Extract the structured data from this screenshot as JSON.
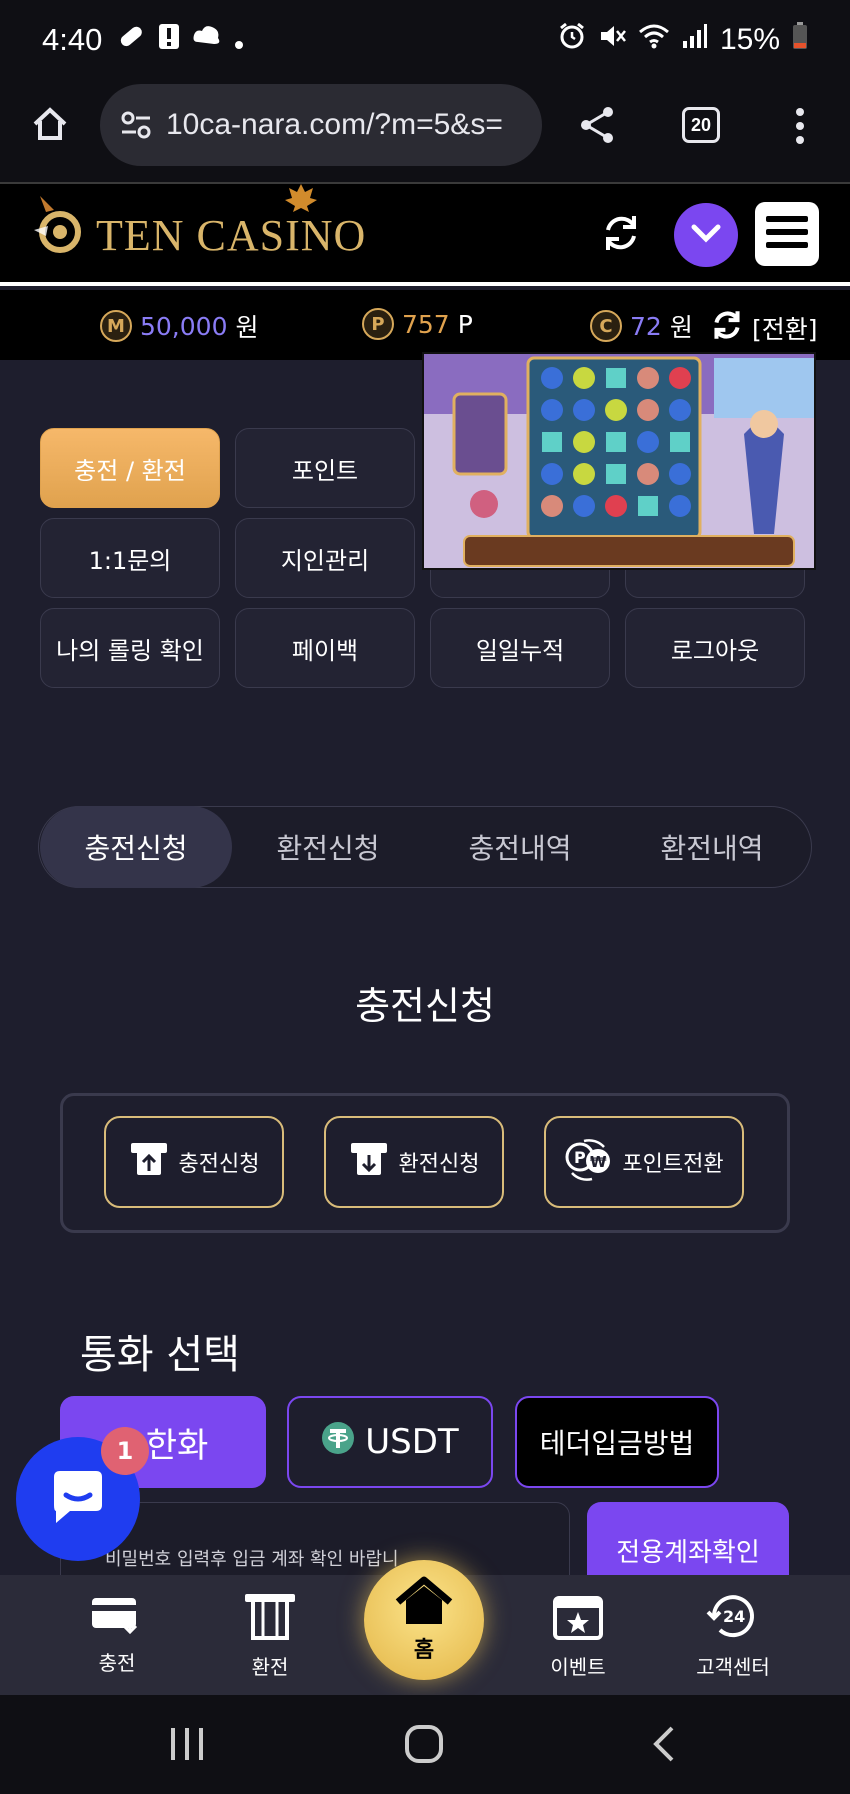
{
  "status_bar": {
    "time": "4:40",
    "battery": "15%"
  },
  "browser": {
    "url": "10ca-nara.com/?m=5&s=",
    "tab_count": "20"
  },
  "site": {
    "logo_text": "TEN CASINO",
    "accent_color": "#7b47f0",
    "gold_color": "#e0a24e"
  },
  "balances": {
    "money": {
      "icon": "M",
      "value": "50,000",
      "unit": "원"
    },
    "point": {
      "icon": "P",
      "value": "757",
      "unit": "P"
    },
    "casino": {
      "icon": "C",
      "value": "72",
      "unit": "원"
    },
    "convert_label": "[전환]"
  },
  "menu": {
    "items": [
      {
        "label": "충전 / 환전"
      },
      {
        "label": "포인트"
      },
      {
        "label": "1:1문의"
      },
      {
        "label": "지인관리"
      },
      {
        "label": "나의 롤링 확인"
      },
      {
        "label": "페이백"
      },
      {
        "label": "일일누적"
      },
      {
        "label": "로그아웃"
      }
    ]
  },
  "tabs": [
    {
      "label": "충전신청"
    },
    {
      "label": "환전신청"
    },
    {
      "label": "충전내역"
    },
    {
      "label": "환전내역"
    }
  ],
  "section_title": "충전신청",
  "actions": [
    {
      "label": "충전신청"
    },
    {
      "label": "환전신청"
    },
    {
      "label": "포인트전환"
    }
  ],
  "currency": {
    "title": "통화 선택",
    "options": [
      {
        "label": "한화"
      },
      {
        "label": "USDT"
      },
      {
        "label": "테더입금방법"
      }
    ]
  },
  "account": {
    "hint": "비밀번호 입력후 입금 계좌 확인 바랍니",
    "button": "전용계좌확인"
  },
  "chat": {
    "badge": "1"
  },
  "bottom_nav": [
    {
      "label": "충전"
    },
    {
      "label": "환전"
    },
    {
      "label": "홈"
    },
    {
      "label": "이벤트"
    },
    {
      "label": "고객센터"
    }
  ]
}
